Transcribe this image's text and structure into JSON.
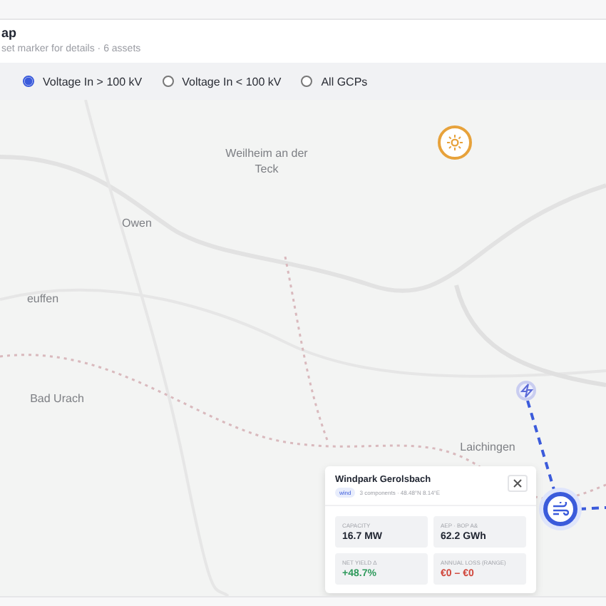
{
  "header": {
    "title": "ap",
    "subtitle": "set marker for details · 6 assets"
  },
  "filters": [
    {
      "label": "Voltage In > 100 kV",
      "selected": true
    },
    {
      "label": "Voltage In < 100 kV",
      "selected": false
    },
    {
      "label": "All GCPs",
      "selected": false
    }
  ],
  "map": {
    "labels": [
      "Weilheim an der Teck",
      "Owen",
      "euffen",
      "Bad Urach",
      "Laichingen"
    ],
    "markers": [
      {
        "kind": "solar",
        "selected": false
      },
      {
        "kind": "substation",
        "selected": false
      },
      {
        "kind": "wind",
        "selected": true
      }
    ]
  },
  "popup": {
    "title": "Windpark Gerolsbach",
    "tag": "wind",
    "meta": "3 components · 48.48°N 8.14°E",
    "stats": [
      {
        "label": "CAPACITY",
        "value": "16.7 MW",
        "color": "#1f2430"
      },
      {
        "label": "AEP · BOP A&",
        "value": "62.2 GWh",
        "color": "#1f2430"
      },
      {
        "label": "NET YIELD Δ",
        "value": "+48.7%",
        "color": "#2f9a5c"
      },
      {
        "label": "ANNUAL LOSS (RANGE)",
        "value": "€0 – €0",
        "color": "#d0453a"
      }
    ]
  }
}
